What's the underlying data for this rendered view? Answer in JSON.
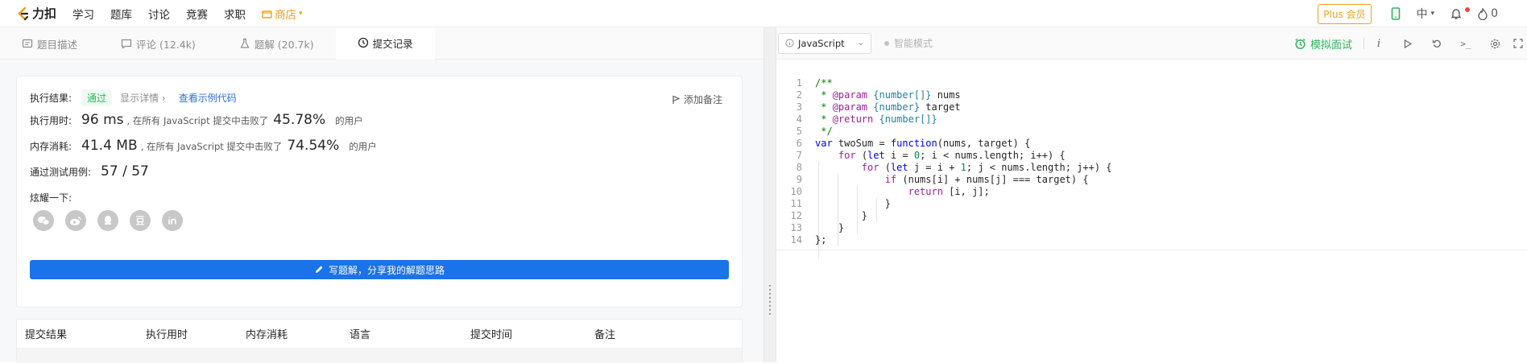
{
  "topbar": {
    "logo_text": "力扣",
    "nav": [
      "学习",
      "题库",
      "讨论",
      "竞赛",
      "求职"
    ],
    "shop_label": "商店",
    "plus_label": "Plus 会员",
    "lang_label": "中",
    "points": "0"
  },
  "tabs": [
    {
      "label": "题目描述",
      "icon": "description-icon"
    },
    {
      "label": "评论 (12.4k)",
      "icon": "comment-icon"
    },
    {
      "label": "题解 (20.7k)",
      "icon": "flask-icon"
    },
    {
      "label": "提交记录",
      "icon": "clock-icon"
    }
  ],
  "result": {
    "status_label": "执行结果:",
    "status_value": "通过",
    "detail_link": "显示详情 ›",
    "example_link": "查看示例代码",
    "add_note": "添加备注",
    "runtime_label": "执行用时:",
    "runtime_value": "96 ms",
    "runtime_text": ", 在所有 JavaScript 提交中击败了",
    "runtime_pct": "45.78%",
    "users": "的用户",
    "memory_label": "内存消耗:",
    "memory_value": "41.4 MB",
    "memory_text": ", 在所有 JavaScript 提交中击败了",
    "memory_pct": "74.54%",
    "tests_label": "通过测试用例:",
    "tests_value": "57 / 57",
    "share_label": "炫耀一下:",
    "share_icons": [
      "wechat-icon",
      "weibo-icon",
      "qq-icon",
      "douban-icon",
      "linkedin-icon"
    ],
    "write_button": "写题解，分享我的解题思路"
  },
  "table": {
    "headers": [
      "提交结果",
      "执行用时",
      "内存消耗",
      "语言",
      "提交时间",
      "备注"
    ]
  },
  "editor": {
    "language": "JavaScript",
    "smart_mode": "智能模式",
    "mock_interview": "模拟面试"
  }
}
